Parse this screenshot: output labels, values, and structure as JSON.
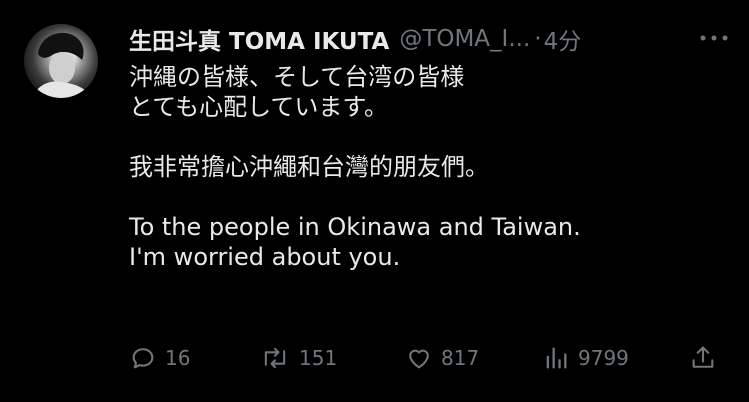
{
  "tweet": {
    "display_name": "生田斗真 TOMA IKUTA",
    "handle": "@TOMA_I...",
    "separator": "·",
    "time": "4分",
    "lines": [
      "沖縄の皆様、そして台湾の皆様",
      "とても心配しています。",
      "",
      "我非常擔心沖繩和台灣的朋友們。",
      "",
      "To the people in Okinawa and Taiwan.",
      "I'm worried about you."
    ]
  },
  "actions": {
    "replies": "16",
    "retweets": "151",
    "likes": "817",
    "views": "9799"
  },
  "icons": {
    "more": "more-horizontal-icon",
    "reply": "reply-icon",
    "retweet": "retweet-icon",
    "like": "heart-icon",
    "views": "analytics-icon",
    "share": "share-icon"
  }
}
